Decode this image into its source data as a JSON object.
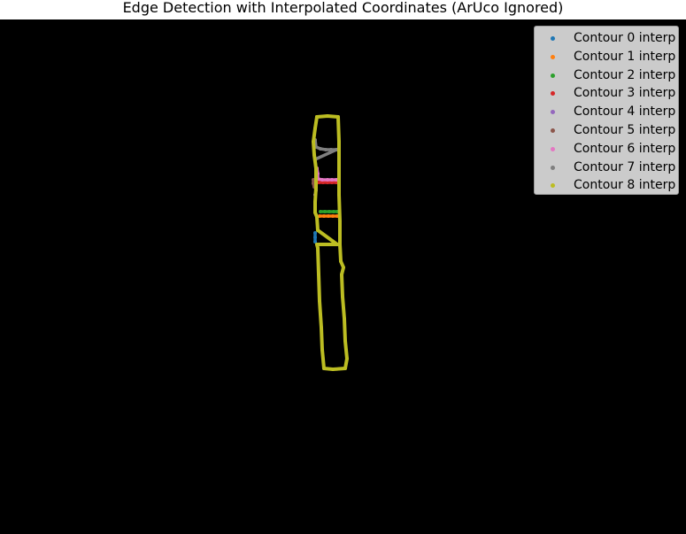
{
  "chart_data": {
    "type": "scatter",
    "title": "Edge Detection with Interpolated Coordinates (ArUco Ignored)",
    "xlabel": "",
    "ylabel": "",
    "legend_position": "top-right",
    "background": "#000000",
    "series": [
      {
        "name": "Contour 0 interp",
        "color": "#1f77b4",
        "points": [
          [
            356,
            263
          ],
          [
            356,
            268
          ],
          [
            356,
            273
          ]
        ]
      },
      {
        "name": "Contour 1 interp",
        "color": "#ff7f0e",
        "points": [
          [
            361,
            244
          ],
          [
            366,
            244
          ],
          [
            371,
            244
          ],
          [
            376,
            244
          ],
          [
            381,
            244
          ]
        ]
      },
      {
        "name": "Contour 2 interp",
        "color": "#2ca02c",
        "points": [
          [
            362,
            239
          ],
          [
            367,
            239
          ],
          [
            372,
            239
          ],
          [
            377,
            239
          ],
          [
            381,
            239
          ]
        ]
      },
      {
        "name": "Contour 3 interp",
        "color": "#d62728",
        "points": [
          [
            360,
            206
          ],
          [
            365,
            206
          ],
          [
            370,
            206
          ],
          [
            375,
            206
          ],
          [
            380,
            206
          ]
        ]
      },
      {
        "name": "Contour 4 interp",
        "color": "#9467bd",
        "points": [
          [
            356,
            210
          ],
          [
            357,
            215
          ],
          [
            356,
            220
          ]
        ]
      },
      {
        "name": "Contour 5 interp",
        "color": "#8c564b",
        "points": [
          [
            354,
            203
          ],
          [
            354,
            207
          ],
          [
            355,
            211
          ]
        ]
      },
      {
        "name": "Contour 6 interp",
        "color": "#e377c2",
        "points": [
          [
            358,
            190
          ],
          [
            359,
            196
          ],
          [
            359,
            202
          ],
          [
            364,
            203
          ],
          [
            370,
            203
          ],
          [
            375,
            203
          ],
          [
            380,
            203
          ]
        ]
      },
      {
        "name": "Contour 7 interp",
        "color": "#7f7f7f",
        "points": [
          [
            356,
            158
          ],
          [
            357,
            166
          ],
          [
            362,
            168
          ],
          [
            368,
            169
          ],
          [
            374,
            169
          ],
          [
            380,
            169
          ],
          [
            356,
            180
          ],
          [
            357,
            192
          ]
        ]
      },
      {
        "name": "Contour 8 interp",
        "color": "#bcbd22",
        "points": [
          [
            358,
            132
          ],
          [
            370,
            131
          ],
          [
            382,
            132
          ],
          [
            383,
            160
          ],
          [
            383,
            190
          ],
          [
            383,
            220
          ],
          [
            384,
            250
          ],
          [
            384,
            276
          ],
          [
            385,
            295
          ],
          [
            388,
            302
          ],
          [
            386,
            310
          ],
          [
            387,
            335
          ],
          [
            389,
            360
          ],
          [
            390,
            385
          ],
          [
            392,
            405
          ],
          [
            390,
            416
          ],
          [
            376,
            417
          ],
          [
            366,
            416
          ],
          [
            364,
            395
          ],
          [
            363,
            370
          ],
          [
            361,
            340
          ],
          [
            360,
            310
          ],
          [
            359,
            280
          ],
          [
            358,
            276
          ],
          [
            372,
            276
          ],
          [
            381,
            276
          ],
          [
            359,
            260
          ],
          [
            358,
            245
          ],
          [
            356,
            240
          ],
          [
            356,
            228
          ],
          [
            357,
            212
          ],
          [
            357,
            190
          ],
          [
            355,
            175
          ],
          [
            354,
            160
          ],
          [
            356,
            145
          ],
          [
            358,
            132
          ]
        ]
      }
    ]
  }
}
